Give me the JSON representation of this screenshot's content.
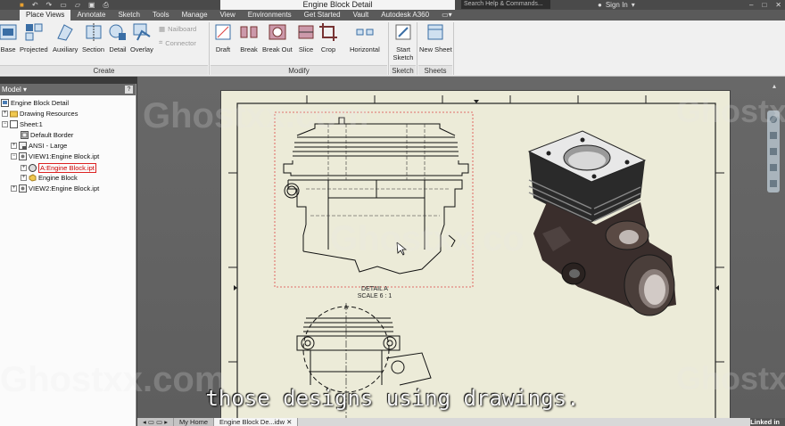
{
  "app": {
    "qat_icons": [
      "app-menu-icon",
      "undo-icon",
      "redo-icon",
      "new-icon",
      "open-icon",
      "save-icon",
      "print-icon"
    ],
    "doc_title": "Engine Block Detail",
    "help_search_placeholder": "Search Help & Commands...",
    "sign_in": "Sign In"
  },
  "ribbon_tabs": [
    {
      "label": "Place Views",
      "active": true
    },
    {
      "label": "Annotate",
      "active": false
    },
    {
      "label": "Sketch",
      "active": false
    },
    {
      "label": "Tools",
      "active": false
    },
    {
      "label": "Manage",
      "active": false
    },
    {
      "label": "View",
      "active": false
    },
    {
      "label": "Environments",
      "active": false
    },
    {
      "label": "Get Started",
      "active": false
    },
    {
      "label": "Vault",
      "active": false
    },
    {
      "label": "Autodesk A360",
      "active": false
    }
  ],
  "ribbon": {
    "create": {
      "label": "Create",
      "buttons": [
        "Base",
        "Projected",
        "Auxiliary",
        "Section",
        "Detail",
        "Overlay"
      ],
      "small": [
        "Nailboard",
        "Connector"
      ]
    },
    "modify": {
      "label": "Modify",
      "buttons": [
        "Draft",
        "Break",
        "Break Out",
        "Slice",
        "Crop",
        "Horizontal"
      ]
    },
    "sketch": {
      "label": "Sketch",
      "buttons": [
        "Start Sketch"
      ]
    },
    "sheets": {
      "label": "Sheets",
      "buttons": [
        "New Sheet"
      ]
    }
  },
  "browser": {
    "title": "Model",
    "help": "?",
    "items": [
      {
        "label": "Engine Block Detail",
        "indent": 0
      },
      {
        "label": "Drawing Resources",
        "indent": 1
      },
      {
        "label": "Sheet:1",
        "indent": 1
      },
      {
        "label": "Default Border",
        "indent": 2
      },
      {
        "label": "ANSI - Large",
        "indent": 2
      },
      {
        "label": "VIEW1:Engine Block.ipt",
        "indent": 2
      },
      {
        "label": "A:Engine Block.ipt",
        "indent": 3
      },
      {
        "label": "Engine Block",
        "indent": 3
      },
      {
        "label": "VIEW2:Engine Block.ipt",
        "indent": 2
      }
    ]
  },
  "drawing": {
    "detail_label": "DETAIL A",
    "detail_scale": "SCALE 6 : 1",
    "detail_callout": "A"
  },
  "bottom_tabs": [
    {
      "label": "My Home",
      "active": false
    },
    {
      "label": "Engine Block De...idw",
      "active": true
    }
  ],
  "subtitle": "those designs using drawings.",
  "watermark": "Ghostxx.com",
  "watermark_short": "Ghostxx.co",
  "linkedin": "Linked in",
  "colors": {
    "sheet": "#ecebd8",
    "accent_red": "#cc2222",
    "canvas": "#626262"
  }
}
